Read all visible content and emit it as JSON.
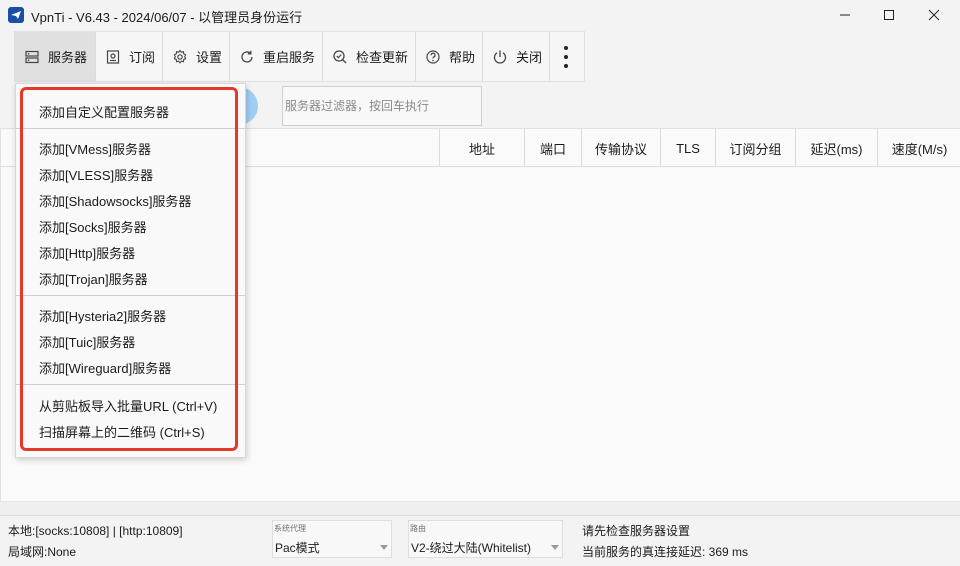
{
  "window": {
    "title": "VpnTi - V6.43 - 2024/06/07 - 以管理员身份运行",
    "icon": "app-logo-icon",
    "controls": [
      "minimize-icon",
      "maximize-icon",
      "close-icon"
    ]
  },
  "toolbar": {
    "items": [
      {
        "label": "服务器",
        "icon": "server-icon",
        "active": true
      },
      {
        "label": "订阅",
        "icon": "subscription-icon"
      },
      {
        "label": "设置",
        "icon": "gear-icon"
      },
      {
        "label": "重启服务",
        "icon": "refresh-icon"
      },
      {
        "label": "检查更新",
        "icon": "check-update-icon"
      },
      {
        "label": "帮助",
        "icon": "help-icon"
      },
      {
        "label": "关闭",
        "icon": "power-icon"
      }
    ],
    "more_icon": "more-vertical-icon"
  },
  "filter": {
    "placeholder": "服务器过滤器，按回车执行",
    "value": ""
  },
  "grid": {
    "columns": [
      "地址",
      "端口",
      "传输协议",
      "TLS",
      "订阅分组",
      "延迟(ms)",
      "速度(M/s)"
    ],
    "rows": []
  },
  "server_menu": {
    "groups": [
      [
        "添加自定义配置服务器"
      ],
      [
        "添加[VMess]服务器",
        "添加[VLESS]服务器",
        "添加[Shadowsocks]服务器",
        "添加[Socks]服务器",
        "添加[Http]服务器",
        "添加[Trojan]服务器"
      ],
      [
        "添加[Hysteria2]服务器",
        "添加[Tuic]服务器",
        "添加[Wireguard]服务器"
      ],
      [
        "从剪贴板导入批量URL (Ctrl+V)",
        "扫描屏幕上的二维码 (Ctrl+S)"
      ]
    ],
    "highlight_color": "#e2392b"
  },
  "status": {
    "local": "本地:[socks:10808] | [http:10809]",
    "lan": "局域网:None",
    "system_proxy_label": "系统代理",
    "system_proxy_value": "Pac模式",
    "routing_label": "路由",
    "routing_value": "V2-绕过大陆(Whitelist)",
    "message": "请先检查服务器设置",
    "latency": "当前服务的真连接延迟: 369 ms"
  },
  "colors": {
    "accent": "#1a4fa3",
    "filter_button": "#9fcff3"
  }
}
